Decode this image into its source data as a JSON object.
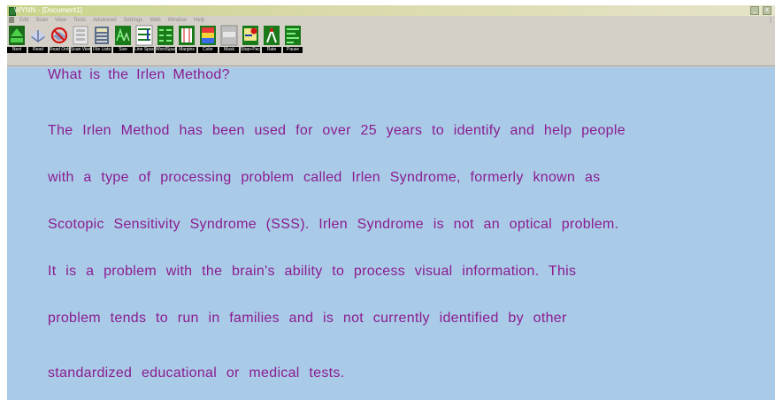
{
  "window": {
    "title": "WYNN - [Document1]",
    "controls": [
      "_",
      "x"
    ]
  },
  "menu": {
    "items": [
      "Edit",
      "Scan",
      "View",
      "Tools",
      "Advanced",
      "Settings",
      "Web",
      "Window",
      "Help"
    ],
    "right_marker": "["
  },
  "toolbar": {
    "buttons": [
      {
        "label": "Next",
        "icon": "next-arrow-icon"
      },
      {
        "label": "Read",
        "icon": "book-icon"
      },
      {
        "label": "Read Only",
        "icon": "no-symbol-icon"
      },
      {
        "label": "Scan View",
        "icon": "scan-view-icon"
      },
      {
        "label": "File Lists",
        "icon": "file-list-icon"
      },
      {
        "label": "Size",
        "icon": "text-size-icon"
      },
      {
        "label": "Line Space",
        "icon": "line-space-icon"
      },
      {
        "label": "WordSpace",
        "icon": "word-space-icon"
      },
      {
        "label": "Margins",
        "icon": "margins-icon"
      },
      {
        "label": "Color",
        "icon": "color-icon"
      },
      {
        "label": "Mask",
        "icon": "mask-icon"
      },
      {
        "label": "Stop+Pace",
        "icon": "stop-pace-icon"
      },
      {
        "label": "Rate",
        "icon": "rate-icon"
      },
      {
        "label": "Pause",
        "icon": "pause-icon"
      }
    ]
  },
  "document": {
    "heading": "What is the Irlen Method?",
    "lines": [
      "The Irlen Method has been used for over 25 years to identify and help people",
      "with a type of processing problem called Irlen Syndrome, formerly known as",
      "Scotopic Sensitivity Syndrome (SSS). Irlen Syndrome is not an optical problem.",
      "It is a problem with the brain's ability to process visual information. This",
      "problem tends to run in families and is not currently identified by other",
      "standardized educational or medical tests."
    ]
  }
}
